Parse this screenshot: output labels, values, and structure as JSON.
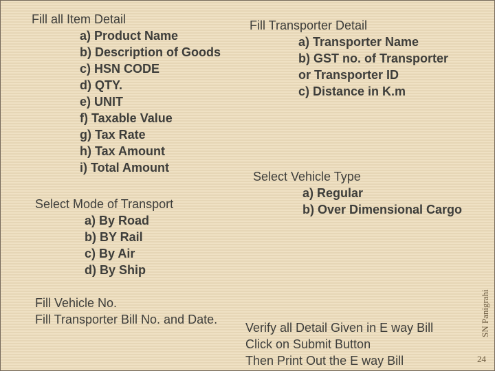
{
  "item_detail": {
    "heading": "Fill all Item Detail",
    "items": [
      "a) Product Name",
      "b) Description of Goods",
      "c) HSN CODE",
      "d) QTY.",
      "e) UNIT",
      "f) Taxable Value",
      "g) Tax Rate",
      "h) Tax Amount",
      "i)  Total Amount"
    ]
  },
  "transporter_detail": {
    "heading": "Fill Transporter Detail",
    "items": [
      "a) Transporter Name",
      "b) GST no. of Transporter",
      "or Transporter ID",
      "c) Distance in K.m"
    ]
  },
  "vehicle_type": {
    "heading": "Select Vehicle Type",
    "items": [
      "a) Regular",
      "b) Over Dimensional Cargo"
    ]
  },
  "mode_of_transport": {
    "heading": "Select Mode of Transport",
    "items": [
      "a) By Road",
      "b) BY Rail",
      "c) By Air",
      "d) By Ship"
    ]
  },
  "vehicle_number": {
    "lines": [
      "Fill Vehicle No.",
      "Fill Transporter Bill No. and Date."
    ]
  },
  "final_steps": {
    "lines": [
      "Verify all Detail Given in E way Bill",
      "Click on Submit Button",
      "Then Print Out the E way Bill"
    ]
  },
  "footer": {
    "author": "SN Panigrahi",
    "page_number": "24"
  },
  "colors": {
    "background": "#eedfc1",
    "border": "#74685a",
    "text": "#3d3d3a",
    "footer_text": "#6b5a3f"
  }
}
